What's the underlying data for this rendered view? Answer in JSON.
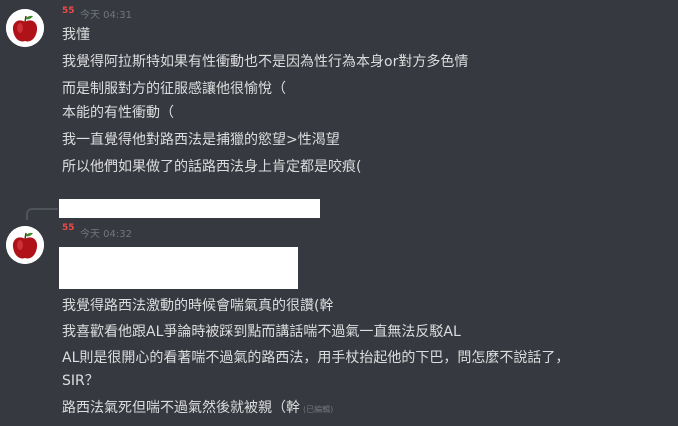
{
  "messages": [
    {
      "username": "55",
      "timestamp": "今天 04:31",
      "lines": [
        "我懂",
        "我覺得阿拉斯特如果有性衝動也不是因為性行為本身or對方多色情",
        "而是制服對方的征服感讓他很愉悅（",
        "本能的有性衝動（",
        "我一直覺得他對路西法是捕獵的慾望>性渴望",
        "所以他們如果做了的話路西法身上肯定都是咬痕("
      ]
    },
    {
      "username": "55",
      "timestamp": "今天 04:32",
      "lines": [
        "我覺得路西法激動的時候會喘氣真的很讚(幹",
        "我喜歡看他跟AL爭論時被踩到點而講話喘不過氣一直無法反駁AL",
        "AL則是很開心的看著喘不過氣的路西法，用手杖抬起他的下巴，問怎麼不說話了，",
        "SIR？",
        "路西法氣死但喘不過氣然後就被親（幹"
      ],
      "edited_label": "(已編輯)"
    }
  ],
  "colors": {
    "background": "#36393f",
    "username": "#f04747",
    "text": "#dcddde",
    "muted": "#72767d"
  }
}
